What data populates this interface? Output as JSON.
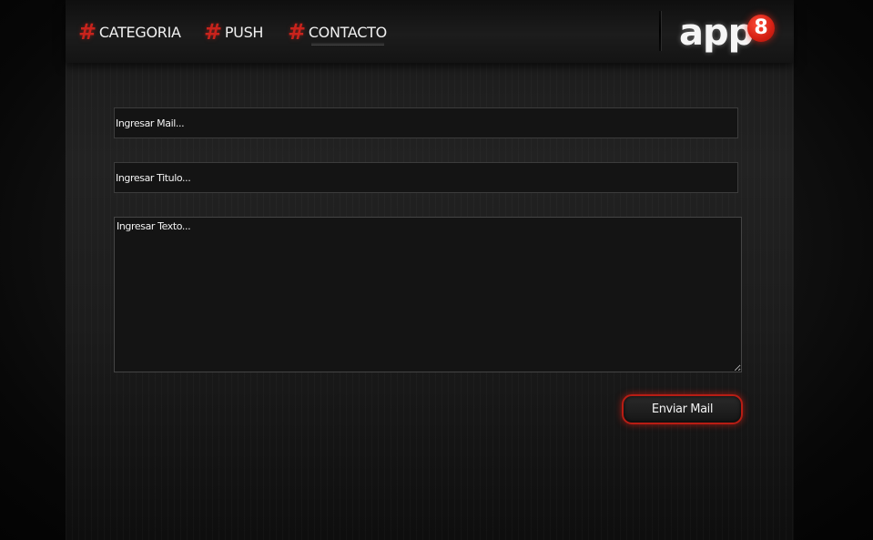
{
  "nav": {
    "items": [
      {
        "label": "CATEGORIA",
        "icon": "hash-icon"
      },
      {
        "label": "PUSH",
        "icon": "hash-icon"
      },
      {
        "label": "CONTACTO",
        "icon": "hash-icon",
        "active": true
      }
    ],
    "hash_glyph": "#"
  },
  "logo": {
    "text": "app",
    "badge": "8"
  },
  "form": {
    "mail_placeholder": "Ingresar Mail...",
    "title_placeholder": "Ingresar Titulo...",
    "text_placeholder": "Ingresar Texto...",
    "mail_value": "",
    "title_value": "",
    "text_value": "",
    "send_label": "Enviar Mail"
  },
  "colors": {
    "accent": "#c8231c",
    "background": "#1c1c1c",
    "text": "#f2f2f2"
  }
}
